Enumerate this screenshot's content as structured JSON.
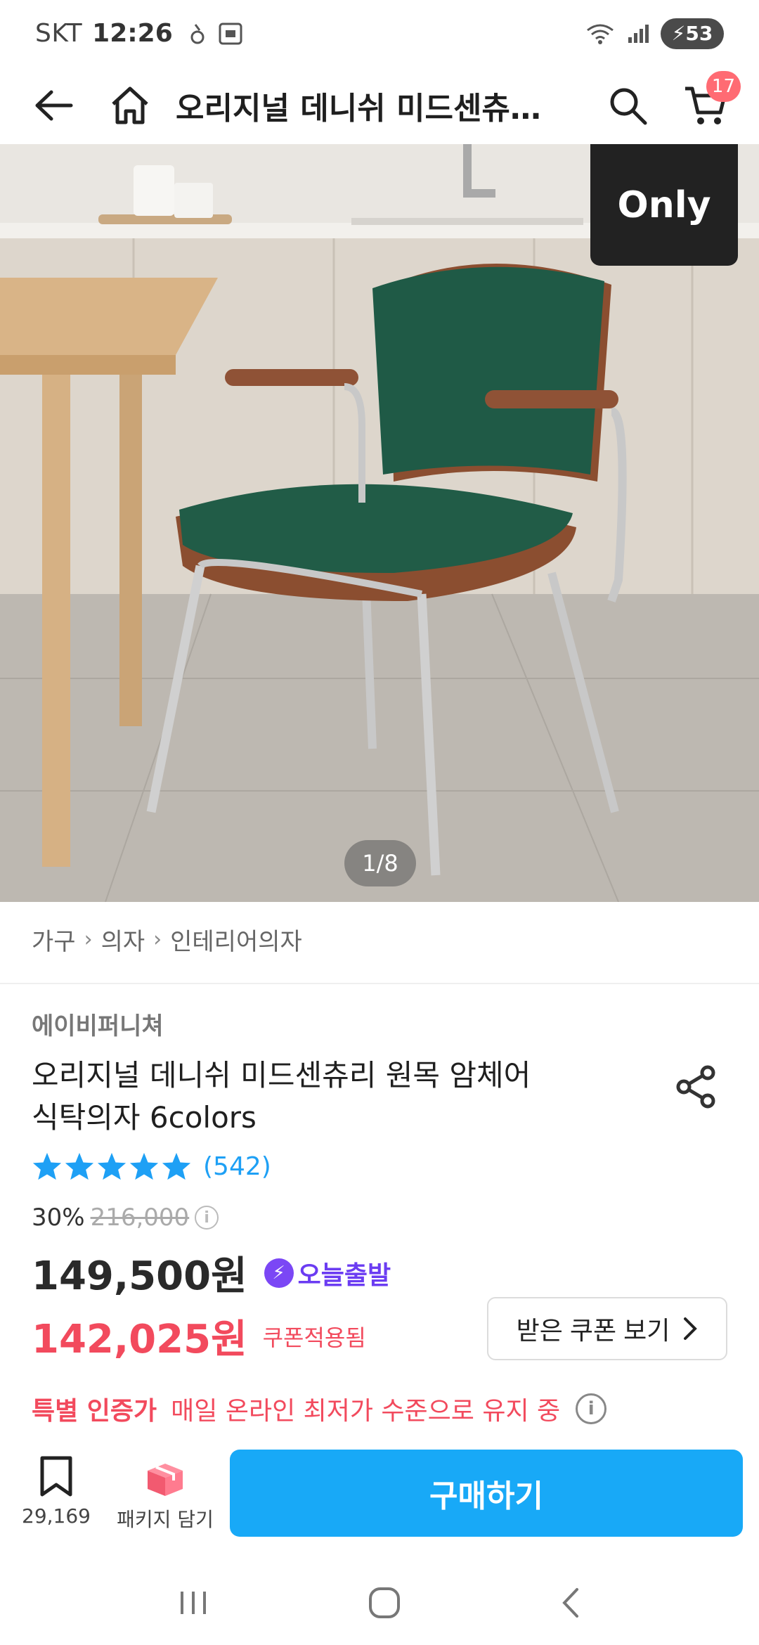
{
  "status_bar": {
    "carrier": "SKT",
    "time": "12:26",
    "battery": "53"
  },
  "header": {
    "title": "오리지널 데니쉬 미드센츄…",
    "cart_count": "17"
  },
  "hero": {
    "badge": "Only",
    "page_indicator": "1/8"
  },
  "breadcrumb": [
    "가구",
    "의자",
    "인테리어의자"
  ],
  "product": {
    "brand": "에이비퍼니쳐",
    "title_line1": "오리지널 데니쉬 미드센츄리 원목 암체어",
    "title_line2": "식탁의자 6colors",
    "rating_stars": 5,
    "review_count": "(542)",
    "discount": "30%",
    "original_price": "216,000",
    "price": "149,500원",
    "today_delivery": "오늘출발",
    "coupon_price": "142,025원",
    "coupon_applied": "쿠폰적용됨",
    "coupon_button": "받은 쿠폰 보기"
  },
  "certification": {
    "title": "특별 인증가",
    "text": "매일 온라인 최저가 수준으로 유지 중"
  },
  "action_bar": {
    "bookmark_count": "29,169",
    "package_label": "패키지 담기",
    "buy_label": "구매하기"
  },
  "colors": {
    "accent_blue": "#18a9f7",
    "sale_red": "#f24a5d",
    "purple": "#6b3cf2",
    "star_blue": "#1ea0f5"
  }
}
